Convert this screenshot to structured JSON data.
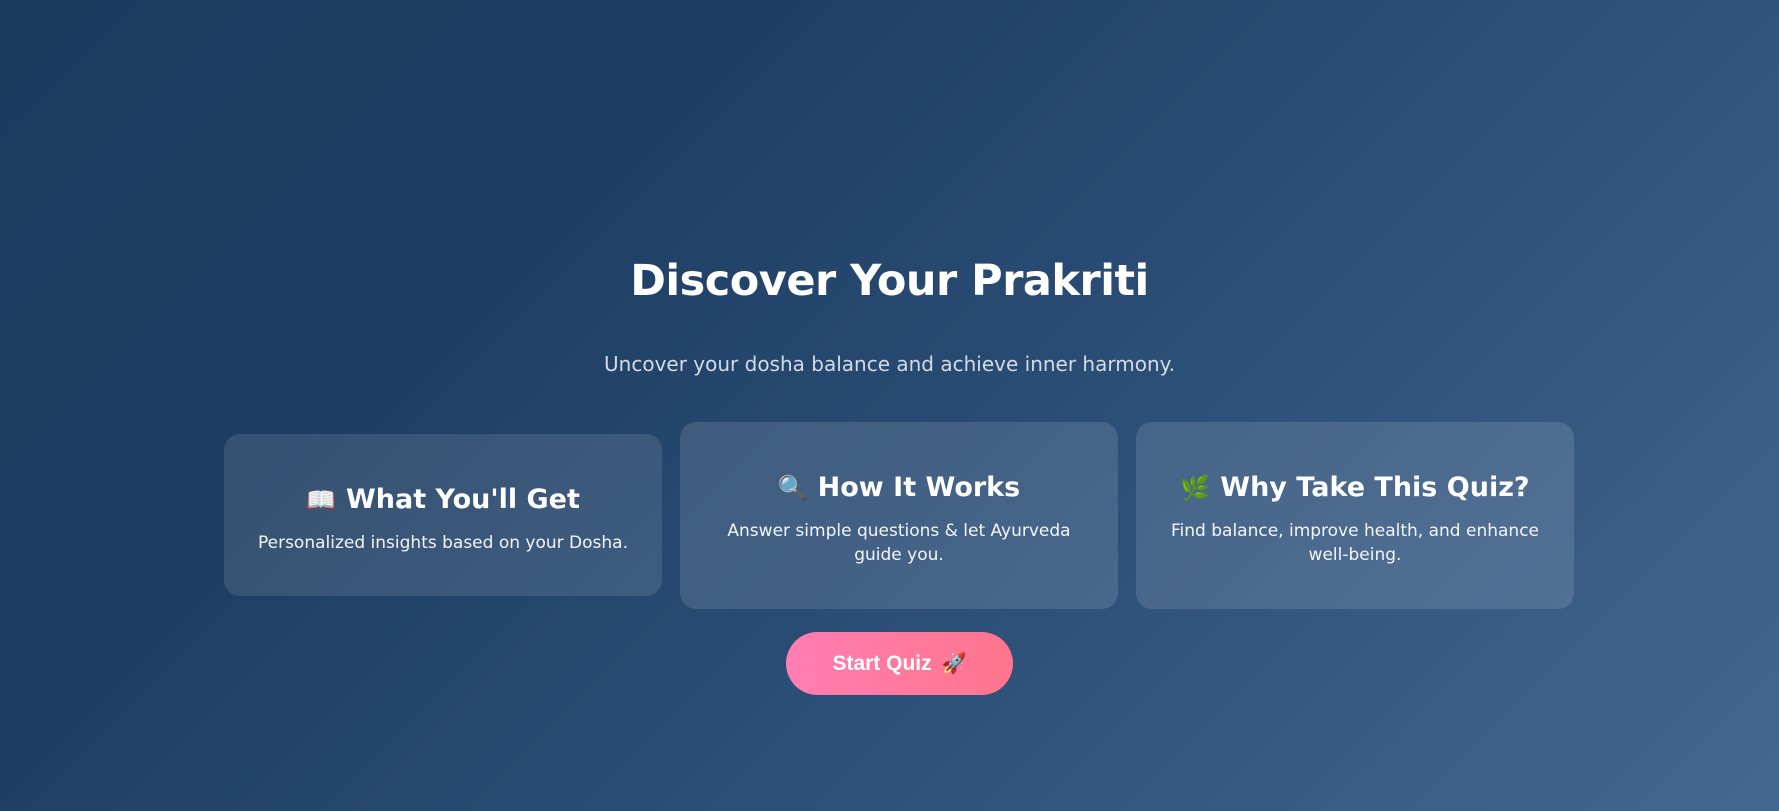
{
  "hero": {
    "title": "Discover Your Prakriti",
    "subtitle": "Uncover your dosha balance and achieve inner harmony."
  },
  "cards": [
    {
      "icon": "book-icon",
      "icon_glyph": "📖",
      "title": "What You'll Get",
      "text": "Personalized insights based on your Dosha."
    },
    {
      "icon": "magnifier-icon",
      "icon_glyph": "🔍",
      "title": "How It Works",
      "text": "Answer simple questions & let Ayurveda guide you."
    },
    {
      "icon": "herb-icon",
      "icon_glyph": "🌿",
      "title": "Why Take This Quiz?",
      "text": "Find balance, improve health, and enhance well-being."
    }
  ],
  "cta": {
    "label": "Start Quiz",
    "icon": "rocket-icon",
    "icon_glyph": "🚀",
    "gradient_start": "#ff7eb3",
    "gradient_end": "#ff758c"
  },
  "colors": {
    "background_start": "#1c3a5e",
    "background_end": "#44668f"
  }
}
